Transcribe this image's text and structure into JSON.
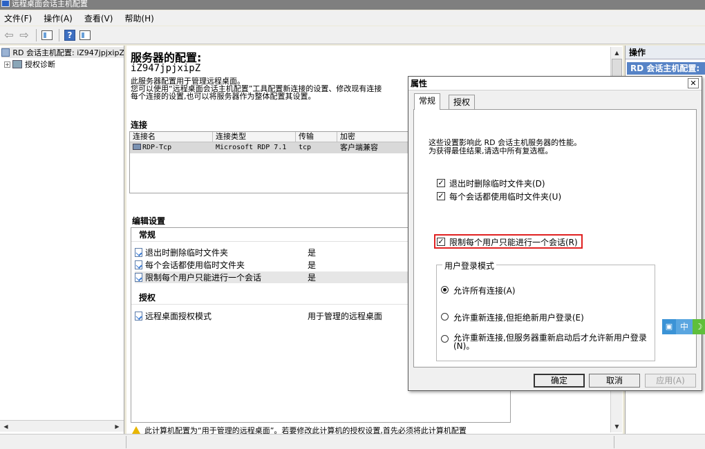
{
  "window": {
    "title": "远程桌面会话主机配置"
  },
  "menu": [
    {
      "label": "文件(F)"
    },
    {
      "label": "操作(A)"
    },
    {
      "label": "查看(V)"
    },
    {
      "label": "帮助(H)"
    }
  ],
  "tree": {
    "root_label": "RD 会话主机配置: iZ947jpjxipZ",
    "child_label": "授权诊断",
    "child_expander": "+"
  },
  "main": {
    "title": "服务器的配置:",
    "server_name": "iZ947jpjxipZ",
    "description": [
      "此服务器配置用于管理远程桌面。",
      "您可以使用“远程桌面会话主机配置”工具配置新连接的设置、修改现有连接",
      "每个连接的设置,也可以将服务器作为整体配置其设置。"
    ],
    "connections_heading": "连接",
    "connections_columns": [
      "连接名",
      "连接类型",
      "传输",
      "加密"
    ],
    "connections_rows": [
      {
        "name": "RDP-Tcp",
        "type": "Microsoft RDP 7.1",
        "transport": "tcp",
        "encryption": "客户端兼容"
      }
    ],
    "edit_heading": "编辑设置",
    "general_group": "常规",
    "general_settings": [
      {
        "label": "退出时删除临时文件夹",
        "value": "是"
      },
      {
        "label": "每个会话都使用临时文件夹",
        "value": "是"
      },
      {
        "label": "限制每个用户只能进行一个会话",
        "value": "是"
      }
    ],
    "licensing_group": "授权",
    "licensing_settings": [
      {
        "label": "远程桌面授权模式",
        "value": "用于管理的远程桌面"
      }
    ],
    "warning": "此计算机配置为“用于管理的远程桌面”。若要修改此计算机的授权设置,首先必须将此计算机配置"
  },
  "actions": {
    "heading": "操作",
    "item": "RD 会话主机配置:"
  },
  "dialog": {
    "title": "属性",
    "close": "✕",
    "tabs": [
      {
        "label": "常规"
      },
      {
        "label": "授权"
      }
    ],
    "description": [
      "这些设置影响此 RD 会话主机服务器的性能。",
      "为获得最佳结果,请选中所有复选框。"
    ],
    "checkboxes": [
      {
        "label": "退出时删除临时文件夹(D)",
        "checked": true
      },
      {
        "label": "每个会话都使用临时文件夹(U)",
        "checked": true
      },
      {
        "label": "限制每个用户只能进行一个会话(R)",
        "checked": true
      }
    ],
    "check_mark": "✓",
    "logon_mode_legend": "用户登录模式",
    "logon_modes": [
      {
        "label": "允许所有连接(A)",
        "selected": true
      },
      {
        "label": "允许重新连接,但拒绝新用户登录(E)",
        "selected": false
      },
      {
        "label": "允许重新连接,但服务器重新启动后才允许新用户登录(N)。",
        "selected": false
      }
    ],
    "buttons": {
      "ok": "确定",
      "cancel": "取消",
      "apply": "应用(A)"
    }
  },
  "ime": {
    "mode": "中",
    "moon": "☽"
  },
  "colors": {
    "highlight_border": "#e02020",
    "action_item_bg": "#5683c6"
  }
}
